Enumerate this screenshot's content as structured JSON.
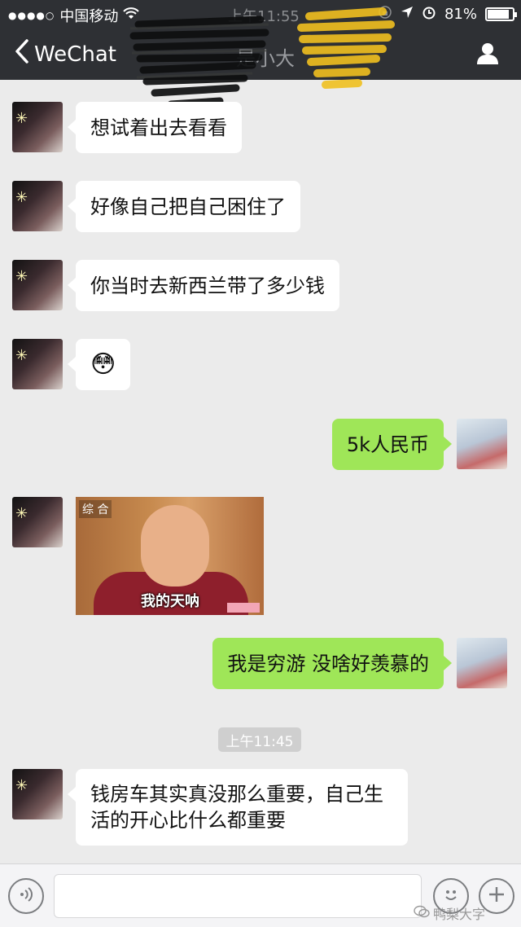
{
  "status_bar": {
    "signal_dots": "●●●●○",
    "carrier": "中国移动",
    "time": "上午11:55",
    "battery": "81%",
    "battery_level": 0.81
  },
  "nav": {
    "back_label": "WeChat",
    "title": "是小大"
  },
  "messages": [
    {
      "side": "left",
      "text": "想试着出去看看"
    },
    {
      "side": "left",
      "text": "好像自己把自己困住了"
    },
    {
      "side": "left",
      "text": "你当时去新西兰带了多少钱"
    },
    {
      "side": "left",
      "text": "😳"
    },
    {
      "side": "right",
      "text": "5k人民币"
    },
    {
      "side": "left",
      "image_tag": "综 合",
      "image_caption": "我的天呐"
    },
    {
      "side": "right",
      "text": "我是穷游 没啥好羡慕的"
    },
    {
      "side": "left",
      "text": "钱房车其实真没那么重要，自己生活的开心比什么都重要"
    }
  ],
  "timestamp": "上午11:45",
  "input": {
    "placeholder": ""
  },
  "watermark": "鸭梨大字",
  "icons": {
    "back": "chevron-left-icon",
    "profile": "person-icon",
    "voice": "voice-icon",
    "emoji": "emoji-icon",
    "plus": "plus-icon"
  },
  "colors": {
    "topbar": "#2e3034",
    "background": "#ebebeb",
    "bubble_left": "#ffffff",
    "bubble_right": "#9fe658"
  }
}
